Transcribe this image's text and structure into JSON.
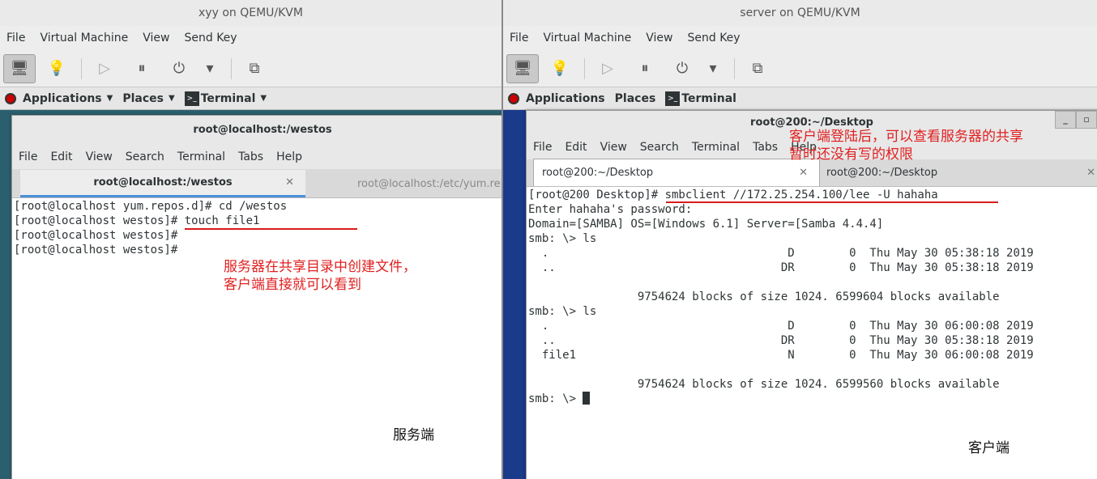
{
  "left_vm": {
    "title": "xyy on QEMU/KVM",
    "menu": [
      "File",
      "Virtual Machine",
      "View",
      "Send Key"
    ],
    "gnome_bar": {
      "applications": "Applications",
      "places": "Places",
      "terminal": "Terminal"
    },
    "terminal": {
      "title": "root@localhost:/westos",
      "menu": [
        "File",
        "Edit",
        "View",
        "Search",
        "Terminal",
        "Tabs",
        "Help"
      ],
      "tabs": [
        "root@localhost:/westos",
        "root@localhost:/etc/yum.re"
      ],
      "lines": [
        "[root@localhost yum.repos.d]# cd /westos",
        "[root@localhost westos]# touch file1",
        "[root@localhost westos]#",
        "[root@localhost westos]#"
      ]
    },
    "annotation": [
      "服务器在共享目录中创建文件，",
      "客户端直接就可以看到"
    ],
    "label": "服务端"
  },
  "right_vm": {
    "title": "server on QEMU/KVM",
    "menu": [
      "File",
      "Virtual Machine",
      "View",
      "Send Key"
    ],
    "gnome_bar": {
      "applications": "Applications",
      "places": "Places",
      "terminal": "Terminal"
    },
    "terminal": {
      "title": "root@200:~/Desktop",
      "menu": [
        "File",
        "Edit",
        "View",
        "Search",
        "Terminal",
        "Tabs",
        "Help"
      ],
      "tabs": [
        "root@200:~/Desktop",
        "root@200:~/Desktop"
      ],
      "lines": [
        "[root@200 Desktop]# smbclient //172.25.254.100/lee -U hahaha",
        "Enter hahaha's password:",
        "Domain=[SAMBA] OS=[Windows 6.1] Server=[Samba 4.4.4]",
        "smb: \\> ls",
        "  .                                   D        0  Thu May 30 05:38:18 2019",
        "  ..                                 DR        0  Thu May 30 05:38:18 2019",
        "",
        "                9754624 blocks of size 1024. 6599604 blocks available",
        "smb: \\> ls",
        "  .                                   D        0  Thu May 30 06:00:08 2019",
        "  ..                                 DR        0  Thu May 30 05:38:18 2019",
        "  file1                               N        0  Thu May 30 06:00:08 2019",
        "",
        "                9754624 blocks of size 1024. 6599560 blocks available"
      ],
      "prompt": "smb: \\> "
    },
    "annotation": [
      "客户端登陆后，可以查看服务器的共享",
      "暂时还没有写的权限"
    ],
    "label": "客户端"
  },
  "colors": {
    "annotation": "#e02020",
    "underline": "#d81b1b",
    "active_tab": "#4a90d9"
  },
  "icons": [
    "monitor-icon",
    "lightbulb-icon",
    "play-icon",
    "pause-icon",
    "power-icon",
    "dropdown-icon",
    "fullscreen-icon",
    "redhat-logo-icon",
    "terminal-icon",
    "close-icon",
    "minimize-icon",
    "maximize-icon"
  ]
}
